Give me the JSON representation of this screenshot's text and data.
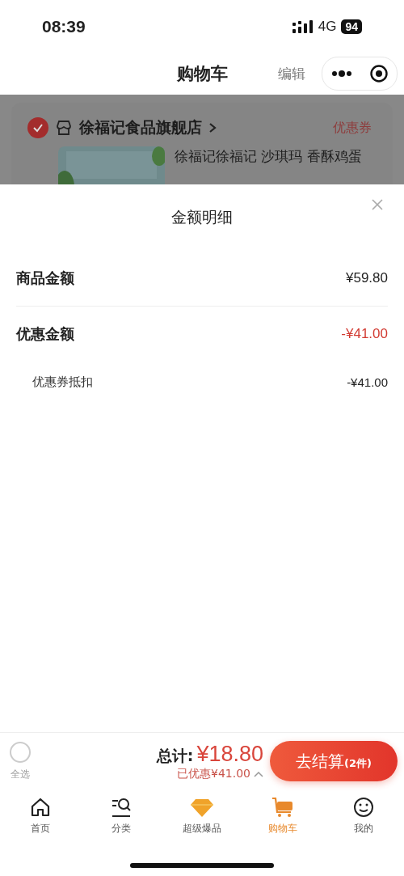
{
  "status_bar": {
    "time": "08:39",
    "network": "4G",
    "battery": "94"
  },
  "nav_bar": {
    "title": "购物车",
    "edit": "编辑"
  },
  "store": {
    "checked": true,
    "name": "徐福记食品旗舰店",
    "coupon": "优惠券",
    "product": {
      "title": "徐福记徐福记 沙琪玛 香酥鸡蛋"
    }
  },
  "sheet": {
    "title": "金额明细",
    "rows": [
      {
        "kind": "main",
        "label": "商品金额",
        "value": "¥59.80",
        "highlight": false
      },
      {
        "kind": "main",
        "label": "优惠金额",
        "value": "-¥41.00",
        "highlight": true
      },
      {
        "kind": "sub",
        "label": "优惠券抵扣",
        "value": "-¥41.00",
        "highlight": false
      }
    ]
  },
  "checkout_bar": {
    "select_all": {
      "label": "全选",
      "checked": false
    },
    "total_label": "总计:",
    "total": "¥18.80",
    "discount": "已优惠¥41.00",
    "expanded": true,
    "button": {
      "label": "去结算",
      "count": "(2件)"
    }
  },
  "tab_bar": [
    {
      "kind": "home",
      "label": "首页",
      "selected": false
    },
    {
      "kind": "category",
      "label": "分类",
      "selected": false
    },
    {
      "kind": "diamond",
      "label": "超级爆品",
      "selected": false
    },
    {
      "kind": "cart",
      "label": "购物车",
      "selected": true
    },
    {
      "kind": "smile",
      "label": "我的",
      "selected": false
    }
  ]
}
